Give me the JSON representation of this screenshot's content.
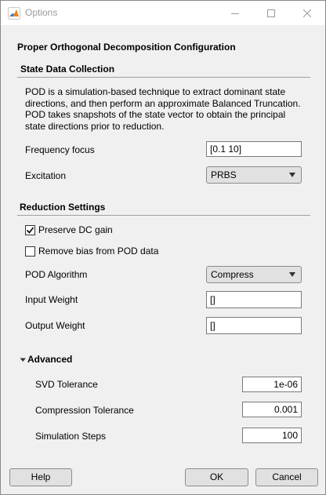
{
  "window": {
    "title": "Options"
  },
  "header": {
    "title": "Proper Orthogonal Decomposition Configuration"
  },
  "state_data": {
    "title": "State Data Collection",
    "description": "POD is a simulation-based technique to extract dominant state directions, and then perform an approximate Balanced Truncation. POD takes snapshots of the state vector to obtain the principal state directions prior to reduction.",
    "frequency_focus_label": "Frequency focus",
    "frequency_focus_value": "[0.1 10]",
    "excitation_label": "Excitation",
    "excitation_value": "PRBS"
  },
  "reduction": {
    "title": "Reduction Settings",
    "preserve_dc_label": "Preserve DC gain",
    "preserve_dc_checked": true,
    "remove_bias_label": "Remove bias from POD data",
    "remove_bias_checked": false,
    "algorithm_label": "POD Algorithm",
    "algorithm_value": "Compress",
    "input_weight_label": "Input Weight",
    "input_weight_value": "[]",
    "output_weight_label": "Output Weight",
    "output_weight_value": "[]"
  },
  "advanced": {
    "title": "Advanced",
    "svd_label": "SVD Tolerance",
    "svd_value": "1e-06",
    "compression_label": "Compression Tolerance",
    "compression_value": "0.001",
    "steps_label": "Simulation Steps",
    "steps_value": "100"
  },
  "footer": {
    "help_label": "Help",
    "ok_label": "OK",
    "cancel_label": "Cancel"
  }
}
